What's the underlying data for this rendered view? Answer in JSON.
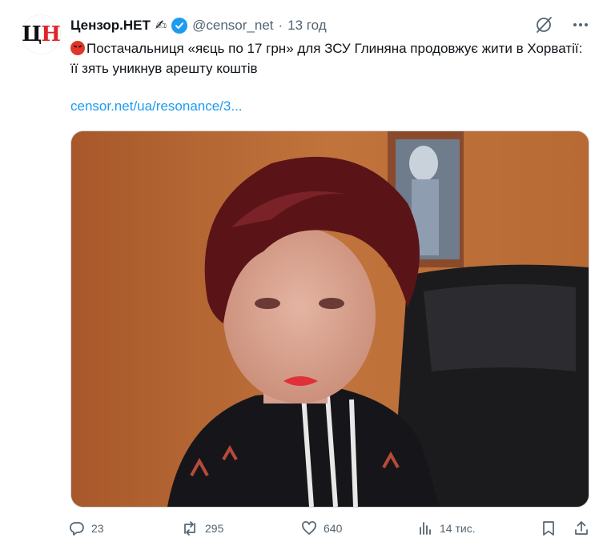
{
  "account": {
    "avatar_letters": [
      "Ц",
      "Н"
    ],
    "name": "Цензор.НЕТ",
    "name_emoji": "✍",
    "handle": "@censor_net",
    "separator": "·",
    "time": "13 год"
  },
  "tweet": {
    "text": "Постачальниця «яєць по 17 грн» для ЗСУ Глиняна продовжує жити в Хорватії: її зять уникнув арешту коштів",
    "link": "censor.net/ua/resonance/3..."
  },
  "stats": {
    "replies": "23",
    "reposts": "295",
    "likes": "640",
    "views": "14 тис."
  },
  "colors": {
    "accent": "#1d9bf0",
    "muted": "#536471",
    "text": "#0f1419"
  }
}
